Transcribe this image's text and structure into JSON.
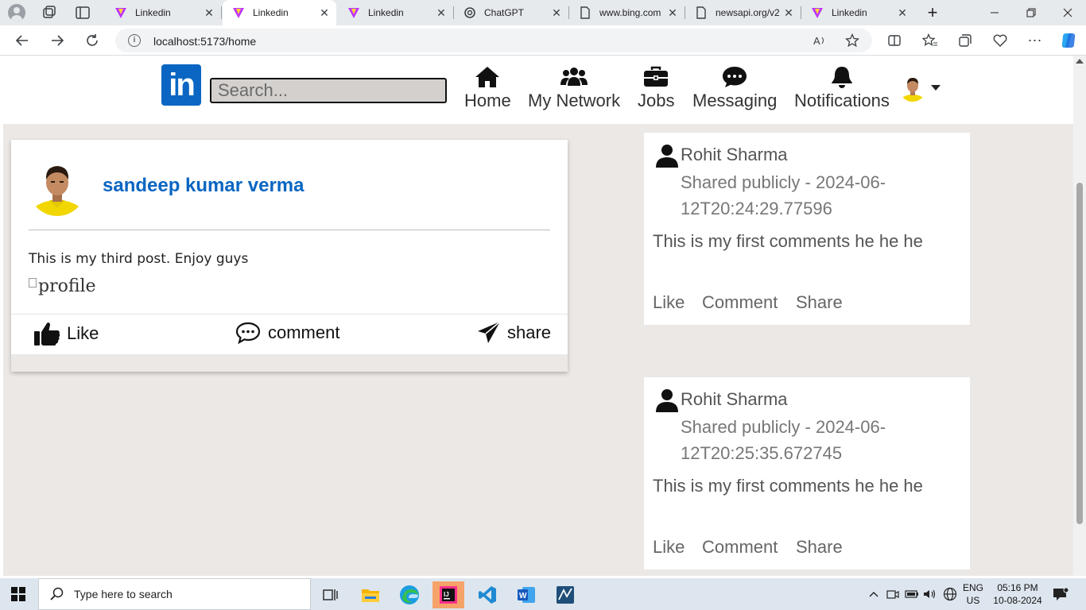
{
  "browser": {
    "tabs": [
      {
        "label": "Linkedin",
        "favicon": "vite-icon"
      },
      {
        "label": "Linkedin",
        "favicon": "vite-icon",
        "active": true
      },
      {
        "label": "Linkedin",
        "favicon": "vite-icon"
      },
      {
        "label": "ChatGPT",
        "favicon": "chatgpt-icon"
      },
      {
        "label": "www.bing.com",
        "favicon": "page-icon"
      },
      {
        "label": "newsapi.org/v2",
        "favicon": "page-icon"
      },
      {
        "label": "Linkedin",
        "favicon": "vite-icon"
      }
    ],
    "new_tab": "+",
    "close_glyph": "✕",
    "url": "localhost:5173/home"
  },
  "app": {
    "logo_text": "in",
    "search_placeholder": "Search...",
    "nav": [
      {
        "label": "Home",
        "icon": "home-icon"
      },
      {
        "label": "My Network",
        "icon": "users-icon"
      },
      {
        "label": "Jobs",
        "icon": "briefcase-icon"
      },
      {
        "label": "Messaging",
        "icon": "chat-icon"
      },
      {
        "label": "Notifications",
        "icon": "bell-icon"
      }
    ]
  },
  "post": {
    "author": "sandeep kumar verma",
    "text": "This is my third post. Enjoy guys",
    "image_alt": "profile",
    "actions": {
      "like": "Like",
      "comment": "comment",
      "share": "share"
    }
  },
  "comments": [
    {
      "name": "Rohit Sharma",
      "meta": "Shared publicly - 2024-06-12T20:24:29.77596",
      "text": "This is my first comments he he he",
      "actions": {
        "like": "Like",
        "comment": "Comment",
        "share": "Share"
      }
    },
    {
      "name": "Rohit Sharma",
      "meta": "Shared publicly - 2024-06-12T20:25:35.672745",
      "text": "This is my first comments he he he",
      "actions": {
        "like": "Like",
        "comment": "Comment",
        "share": "Share"
      }
    }
  ],
  "taskbar": {
    "search_placeholder": "Type here to search",
    "lang": {
      "line1": "ENG",
      "line2": "US"
    },
    "clock": {
      "time": "05:16 PM",
      "date": "10-08-2024"
    }
  },
  "colors": {
    "brand": "#0a66c2",
    "page_bg": "#ece8e6",
    "taskbar": "#dde6ee"
  }
}
